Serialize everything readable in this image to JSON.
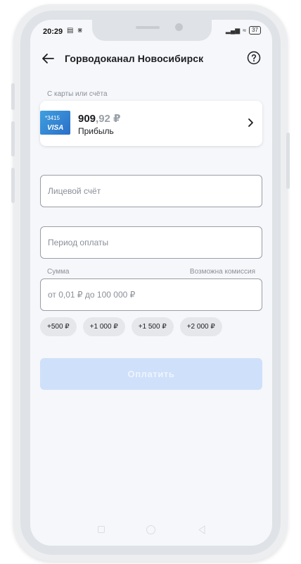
{
  "status_bar": {
    "time": "20:29",
    "battery": "37"
  },
  "header": {
    "title": "Горводоканал Новосибирск"
  },
  "source": {
    "label": "С карты или счёта",
    "card_last4": "*3415",
    "card_brand": "VISA",
    "balance_int": "909",
    "balance_frac": ",92 ₽",
    "account_name": "Прибыль"
  },
  "fields": {
    "account_placeholder": "Лицевой счёт",
    "period_placeholder": "Период оплаты",
    "amount_label": "Сумма",
    "commission_label": "Возможна комиссия",
    "amount_placeholder": "от 0,01 ₽ до 100 000 ₽"
  },
  "chips": [
    "+500 ₽",
    "+1 000 ₽",
    "+1 500 ₽",
    "+2 000 ₽"
  ],
  "pay_button": {
    "label": "Оплатить",
    "disabled": true
  },
  "colors": {
    "accent_disabled": "#cfe0fa",
    "card_blue": "#2b6fc7"
  },
  "icons": [
    "back-arrow-icon",
    "help-icon",
    "chevron-right-icon",
    "visa-card-icon"
  ]
}
